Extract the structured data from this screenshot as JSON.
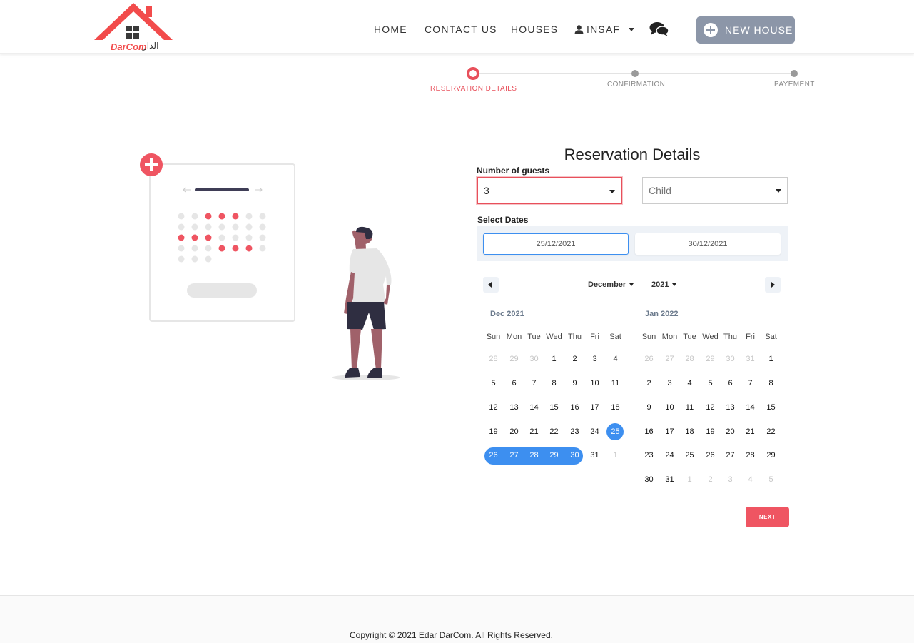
{
  "nav": {
    "brand": "DarCom",
    "brand_arabic": "الدار",
    "home": "HOME",
    "contact": "CONTACT US",
    "houses": "HOUSES",
    "user": "INSAF",
    "new_house": "NEW HOUSE"
  },
  "stepper": {
    "steps": [
      {
        "label": "RESERVATION DETAILS",
        "state": "active"
      },
      {
        "label": "CONFIRMATION",
        "state": "pending"
      },
      {
        "label": "PAYEMENT",
        "state": "pending"
      }
    ]
  },
  "form": {
    "title": "Reservation Details",
    "guests_label": "Number of guests",
    "guests_value": "3",
    "child_placeholder": "Child",
    "dates_label": "Select Dates",
    "start_date": "25/12/2021",
    "end_date": "30/12/2021"
  },
  "calendar": {
    "month_select": "December",
    "year_select": "2021",
    "weekdays": [
      "Sun",
      "Mon",
      "Tue",
      "Wed",
      "Thu",
      "Fri",
      "Sat"
    ],
    "months": [
      {
        "title": "Dec 2021",
        "weeks": [
          [
            "28",
            "29",
            "30",
            "1",
            "2",
            "3",
            "4"
          ],
          [
            "5",
            "6",
            "7",
            "8",
            "9",
            "10",
            "11"
          ],
          [
            "12",
            "13",
            "14",
            "15",
            "16",
            "17",
            "18"
          ],
          [
            "19",
            "20",
            "21",
            "22",
            "23",
            "24",
            "25"
          ],
          [
            "26",
            "27",
            "28",
            "29",
            "30",
            "31",
            "1"
          ]
        ]
      },
      {
        "title": "Jan 2022",
        "weeks": [
          [
            "26",
            "27",
            "28",
            "29",
            "30",
            "31",
            "1"
          ],
          [
            "2",
            "3",
            "4",
            "5",
            "6",
            "7",
            "8"
          ],
          [
            "9",
            "10",
            "11",
            "12",
            "13",
            "14",
            "15"
          ],
          [
            "16",
            "17",
            "18",
            "19",
            "20",
            "21",
            "22"
          ],
          [
            "23",
            "24",
            "25",
            "26",
            "27",
            "28",
            "29"
          ],
          [
            "30",
            "31",
            "1",
            "2",
            "3",
            "4",
            "5"
          ]
        ]
      }
    ]
  },
  "next_label": "NEXT",
  "footer": {
    "copyright": "Copyright © 2021 Edar DarCom. All Rights Reserved."
  },
  "colors": {
    "accent": "#e8505b",
    "selected": "#3d8ff0",
    "new_house_bg": "#8c96a8"
  }
}
